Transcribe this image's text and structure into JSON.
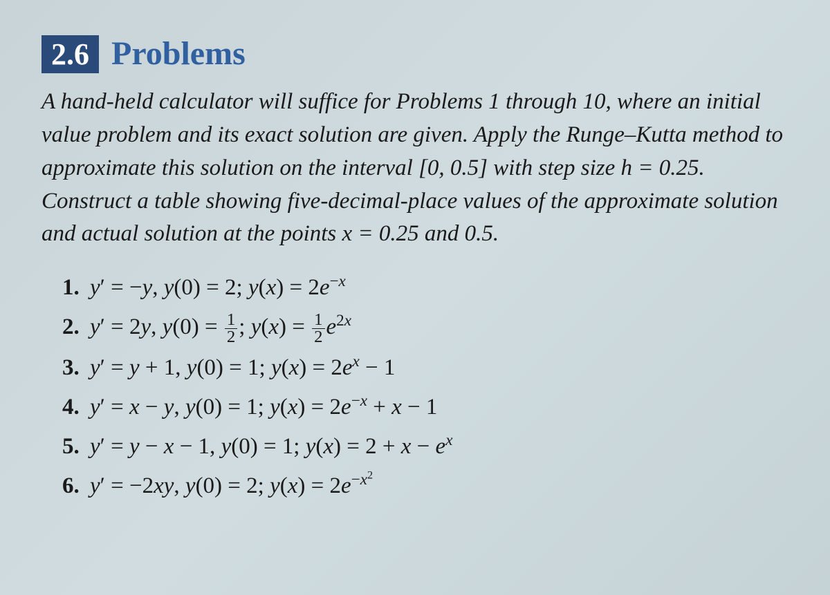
{
  "section": {
    "number": "2.6",
    "title": "Problems"
  },
  "instructions": "A hand-held calculator will suffice for Problems 1 through 10, where an initial value problem and its exact solution are given. Apply the Runge–Kutta method to approximate this solution on the interval [0, 0.5] with step size h = 0.25. Construct a table showing five-decimal-place values of the approximate solution and actual solution at the points x = 0.25 and 0.5.",
  "problems": [
    {
      "number": "1.",
      "equation_html": "<span class='italic'>y</span>′ = −<span class='italic'>y</span>, <span class='italic'>y</span>(0) = 2; <span class='italic'>y</span>(<span class='italic'>x</span>) = 2<span class='italic'>e</span><sup>−<span class='italic'>x</span></sup>"
    },
    {
      "number": "2.",
      "equation_html": "<span class='italic'>y</span>′ = 2<span class='italic'>y</span>, <span class='italic'>y</span>(0) = <span class='frac'><span class='num'>1</span><span class='den'>2</span></span>; <span class='italic'>y</span>(<span class='italic'>x</span>) = <span class='frac'><span class='num'>1</span><span class='den'>2</span></span><span class='italic'>e</span><sup>2<span class='italic'>x</span></sup>"
    },
    {
      "number": "3.",
      "equation_html": "<span class='italic'>y</span>′ = <span class='italic'>y</span> + 1, <span class='italic'>y</span>(0) = 1; <span class='italic'>y</span>(<span class='italic'>x</span>) = 2<span class='italic'>e</span><sup><span class='italic'>x</span></sup> − 1"
    },
    {
      "number": "4.",
      "equation_html": "<span class='italic'>y</span>′ = <span class='italic'>x</span> − <span class='italic'>y</span>, <span class='italic'>y</span>(0) = 1; <span class='italic'>y</span>(<span class='italic'>x</span>) = 2<span class='italic'>e</span><sup>−<span class='italic'>x</span></sup> + <span class='italic'>x</span> − 1"
    },
    {
      "number": "5.",
      "equation_html": "<span class='italic'>y</span>′ = <span class='italic'>y</span> − <span class='italic'>x</span> − 1, <span class='italic'>y</span>(0) = 1; <span class='italic'>y</span>(<span class='italic'>x</span>) = 2 + <span class='italic'>x</span> − <span class='italic'>e</span><sup><span class='italic'>x</span></sup>"
    },
    {
      "number": "6.",
      "equation_html": "<span class='italic'>y</span>′ = −2<span class='italic'>xy</span>, <span class='italic'>y</span>(0) = 2; <span class='italic'>y</span>(<span class='italic'>x</span>) = 2<span class='italic'>e</span><sup>−<span class='italic'>x</span><sup>2</sup></sup>"
    }
  ]
}
